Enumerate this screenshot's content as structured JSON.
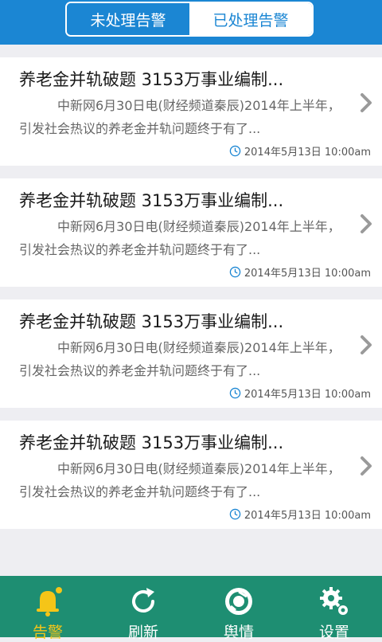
{
  "header": {
    "tabs": [
      {
        "label": "未处理告警"
      },
      {
        "label": "已处理告警"
      }
    ]
  },
  "alerts": [
    {
      "title": "养老金并轨破题 3153万事业编制...",
      "summary": "中新网6月30日电(财经频道秦辰)2014年上半年，引发社会热议的养老金并轨问题终于有了...",
      "time": "2014年5月13日 10:00am"
    },
    {
      "title": "养老金并轨破题 3153万事业编制...",
      "summary": "中新网6月30日电(财经频道秦辰)2014年上半年，引发社会热议的养老金并轨问题终于有了...",
      "time": "2014年5月13日 10:00am"
    },
    {
      "title": "养老金并轨破题 3153万事业编制...",
      "summary": "中新网6月30日电(财经频道秦辰)2014年上半年，引发社会热议的养老金并轨问题终于有了...",
      "time": "2014年5月13日 10:00am"
    },
    {
      "title": "养老金并轨破题 3153万事业编制...",
      "summary": "中新网6月30日电(财经频道秦辰)2014年上半年，引发社会热议的养老金并轨问题终于有了...",
      "time": "2014年5月13日 10:00am"
    }
  ],
  "tabbar": {
    "items": [
      {
        "label": "告警",
        "icon": "bell-icon"
      },
      {
        "label": "刷新",
        "icon": "refresh-icon"
      },
      {
        "label": "舆情",
        "icon": "sentiment-icon"
      },
      {
        "label": "设置",
        "icon": "gear-icon"
      }
    ]
  },
  "colors": {
    "header": "#1b86d3",
    "tabbar": "#1e8e72",
    "active_tab": "#f5c518"
  }
}
